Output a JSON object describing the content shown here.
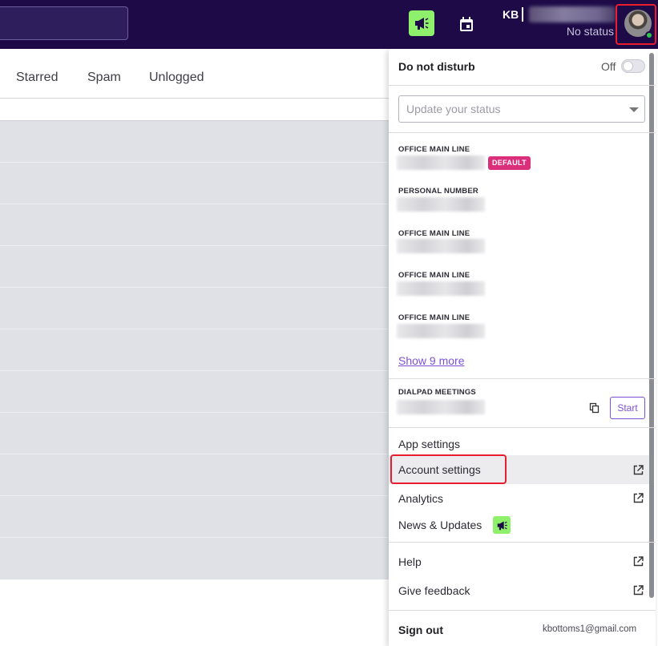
{
  "topbar": {
    "user_initials": "KB",
    "user_status": "No status",
    "icons": {
      "announce": "megaphone-icon",
      "calendar": "calendar-icon"
    },
    "colors": {
      "bar": "#1d0a47",
      "accent_green": "#8ef06b"
    }
  },
  "tabs": [
    {
      "label": "Starred"
    },
    {
      "label": "Spam"
    },
    {
      "label": "Unlogged"
    }
  ],
  "menu": {
    "dnd": {
      "label": "Do not disturb",
      "state_label": "Off"
    },
    "status_select": {
      "placeholder": "Update your status"
    },
    "lines": [
      {
        "label": "OFFICE MAIN LINE",
        "badge": "DEFAULT"
      },
      {
        "label": "PERSONAL NUMBER"
      },
      {
        "label": "OFFICE MAIN LINE"
      },
      {
        "label": "OFFICE MAIN LINE"
      },
      {
        "label": "OFFICE MAIN LINE"
      }
    ],
    "show_more": "Show 9 more",
    "meetings": {
      "label": "DIALPAD MEETINGS",
      "start_label": "Start"
    },
    "items": {
      "app_settings": "App settings",
      "account_settings": "Account settings",
      "analytics": "Analytics",
      "news_updates": "News & Updates",
      "help": "Help",
      "give_feedback": "Give feedback"
    },
    "sign_out": "Sign out",
    "email": "kbottoms1@gmail.com",
    "colors": {
      "link": "#7b52d6",
      "badge": "#db2f7c",
      "highlight": "#e81d2d"
    }
  }
}
